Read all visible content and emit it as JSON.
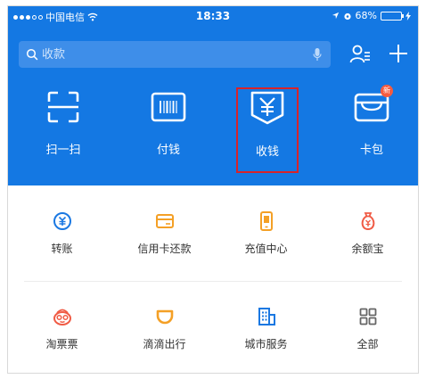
{
  "status_bar": {
    "carrier": "中国电信",
    "time": "18:33",
    "battery": "68%",
    "battery_level": 0.68
  },
  "search": {
    "placeholder": "收款"
  },
  "actions": [
    {
      "label": "扫一扫",
      "icon": "scan-icon"
    },
    {
      "label": "付钱",
      "icon": "barcode-icon"
    },
    {
      "label": "收钱",
      "icon": "yuan-receive-icon"
    },
    {
      "label": "卡包",
      "icon": "card-wallet-icon"
    }
  ],
  "badge_text": "新",
  "services": [
    {
      "label": "转账",
      "icon": "transfer-icon",
      "color": "#1a78e2"
    },
    {
      "label": "信用卡还款",
      "icon": "credit-card-icon",
      "color": "#f4a026"
    },
    {
      "label": "充值中心",
      "icon": "phone-topup-icon",
      "color": "#f4a026"
    },
    {
      "label": "余额宝",
      "icon": "money-bag-icon",
      "color": "#f05b45"
    },
    {
      "label": "淘票票",
      "icon": "ticket-mascot-icon",
      "color": "#f05b45"
    },
    {
      "label": "滴滴出行",
      "icon": "didi-icon",
      "color": "#f4a026"
    },
    {
      "label": "城市服务",
      "icon": "city-building-icon",
      "color": "#1a78e2"
    },
    {
      "label": "全部",
      "icon": "grid-all-icon",
      "color": "#666666"
    }
  ],
  "colors": {
    "header_bg": "#1478e3",
    "highlight_border": "#d8232a"
  }
}
